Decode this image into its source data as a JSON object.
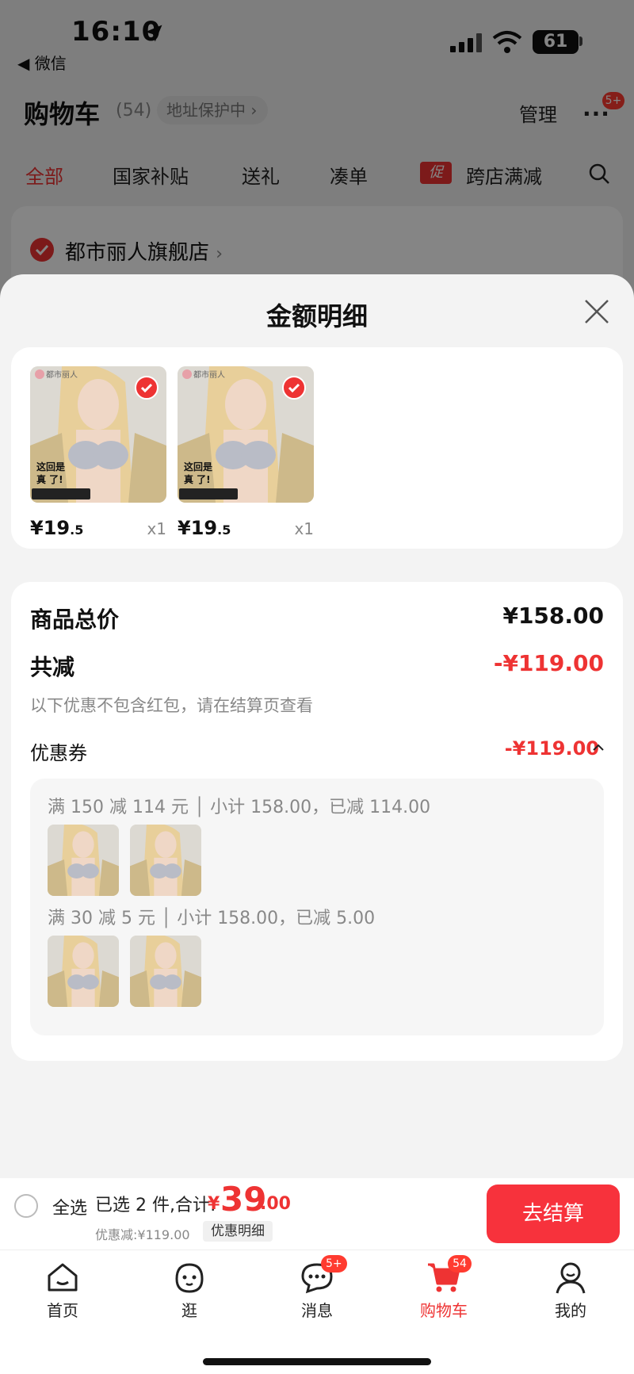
{
  "status_bar": {
    "time": "16:10",
    "back_app": "◀ 微信",
    "battery": "61"
  },
  "cart_header": {
    "title": "购物车",
    "count": "(54)",
    "address_pill": "地址保护中 ›",
    "manage": "管理",
    "more_badge": "5+"
  },
  "filter_tabs": [
    {
      "label": "全部",
      "active": true
    },
    {
      "label": "国家补贴",
      "active": false
    },
    {
      "label": "送礼",
      "active": false
    },
    {
      "label": "凑单",
      "active": false
    },
    {
      "label": "跨店满减",
      "active": false
    }
  ],
  "promo_tag": "促",
  "shop": {
    "name": "都市丽人旗舰店",
    "chevron": "›"
  },
  "sheet": {
    "title": "金额明细",
    "items": [
      {
        "price_int": "¥19",
        "price_dec": ".5",
        "qty": "x1",
        "brand": "都市丽人",
        "overlay_text_1": "这回是",
        "overlay_text_2": "真  了!"
      },
      {
        "price_int": "¥19",
        "price_dec": ".5",
        "qty": "x1",
        "brand": "都市丽人",
        "overlay_text_1": "这回是",
        "overlay_text_2": "真  了!"
      }
    ],
    "summary": {
      "total_label": "商品总价",
      "total_value": "¥158.00",
      "discount_label": "共减",
      "discount_value": "-¥119.00",
      "note": "以下优惠不包含红包，请在结算页查看",
      "coupon_label": "优惠券",
      "coupon_value": "-¥119.00",
      "coupon_groups": [
        {
          "line": "满 150 减 114 元 │ 小计 158.00，已减 114.00"
        },
        {
          "line": "满 30 减 5 元 │ 小计 158.00，已减 5.00"
        }
      ]
    }
  },
  "checkout_bar": {
    "select_all": "全选",
    "selected": "已选 2 件,合计:",
    "currency": "¥",
    "total_int": "39",
    "total_dec": ".00",
    "discount": "优惠减:¥119.00",
    "detail_link": "优惠明细",
    "checkout_button": "去结算"
  },
  "tabbar": [
    {
      "label": "首页",
      "icon": "home-icon",
      "active": false,
      "badge": ""
    },
    {
      "label": "逛",
      "icon": "browse-face-icon",
      "active": false,
      "badge": ""
    },
    {
      "label": "消息",
      "icon": "message-icon",
      "active": false,
      "badge": "5+"
    },
    {
      "label": "购物车",
      "icon": "cart-icon",
      "active": true,
      "badge": "54"
    },
    {
      "label": "我的",
      "icon": "profile-icon",
      "active": false,
      "badge": ""
    }
  ],
  "colors": {
    "accent": "#e33333",
    "checkout": "#f7323c",
    "sheet_bg": "#f3f3f3"
  }
}
